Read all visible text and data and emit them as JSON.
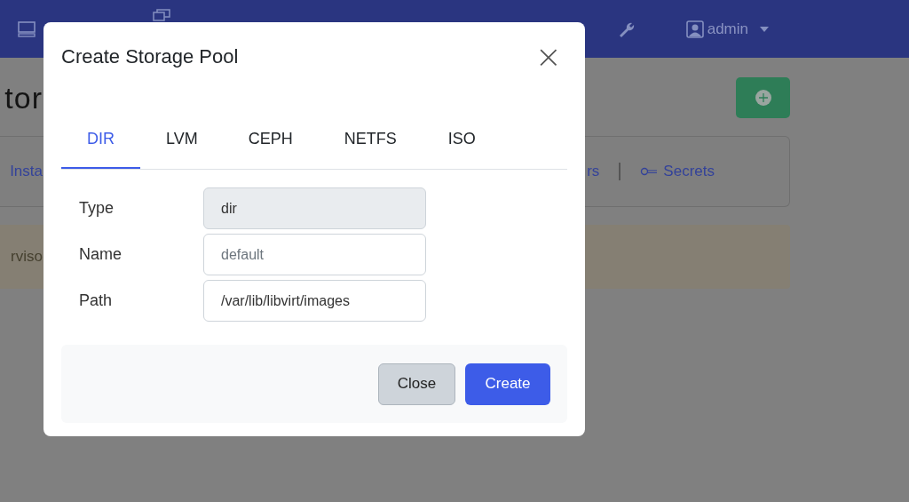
{
  "navbar": {
    "user": "admin"
  },
  "page": {
    "heading_fragment": "tor",
    "links_fragment": "Insta",
    "links": [
      {
        "label": "rs"
      },
      {
        "label": "Secrets"
      }
    ],
    "alert_fragment": "rviso"
  },
  "dialog": {
    "title": "Create Storage Pool",
    "close_symbol": "×",
    "tabs": [
      {
        "label": "DIR",
        "selected": true
      },
      {
        "label": "LVM",
        "selected": false
      },
      {
        "label": "CEPH",
        "selected": false
      },
      {
        "label": "NETFS",
        "selected": false
      },
      {
        "label": "ISO",
        "selected": false
      }
    ],
    "fields": [
      {
        "label": "Type",
        "value": "dir",
        "disabled": true
      },
      {
        "label": "Name",
        "placeholder": "default",
        "disabled": false
      },
      {
        "label": "Path",
        "value": "/var/lib/libvirt/images",
        "disabled": false
      }
    ],
    "buttons": [
      {
        "label": "Close",
        "kind": "secondary"
      },
      {
        "label": "Create",
        "kind": "primary"
      }
    ]
  }
}
